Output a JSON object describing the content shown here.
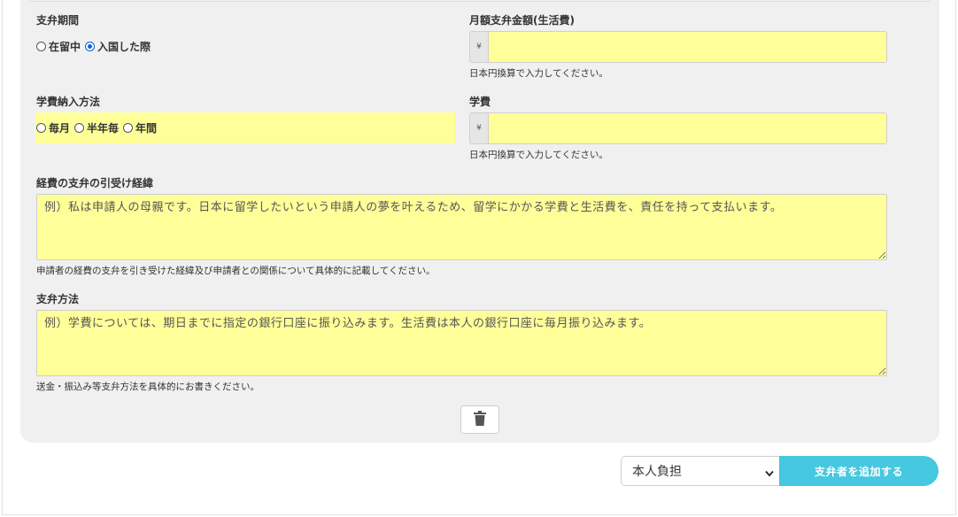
{
  "payment_period": {
    "label": "支弁期間",
    "options": [
      "在留中",
      "入国した際"
    ],
    "selected": "入国した際"
  },
  "monthly_amount": {
    "label": "月額支弁金額(生活費)",
    "currency": "¥",
    "value": "",
    "help": "日本円換算で入力してください。"
  },
  "tuition_method": {
    "label": "学費納入方法",
    "options": [
      "毎月",
      "半年毎",
      "年間"
    ],
    "selected": ""
  },
  "tuition": {
    "label": "学費",
    "currency": "¥",
    "value": "",
    "help": "日本円換算で入力してください。"
  },
  "background": {
    "label": "経費の支弁の引受け経緯",
    "placeholder": "例）私は申請人の母親です。日本に留学したいという申請人の夢を叶えるため、留学にかかる学費と生活費を、責任を持って支払います。",
    "help": "申請者の経費の支弁を引き受けた経緯及び申請者との関係について具体的に記載してください。"
  },
  "payment_method": {
    "label": "支弁方法",
    "placeholder": "例）学費については、期日までに指定の銀行口座に振り込みます。生活費は本人の銀行口座に毎月振り込みます。",
    "help": "送金・振込み等支弁方法を具体的にお書きください。"
  },
  "delete": {
    "icon": "trash-icon"
  },
  "footer": {
    "sponsor_select_value": "本人負担",
    "add_button_label": "支弁者を追加する"
  },
  "colors": {
    "required_highlight": "#ffff99",
    "accent": "#45c8e0",
    "card_bg": "#f0f0f0"
  }
}
